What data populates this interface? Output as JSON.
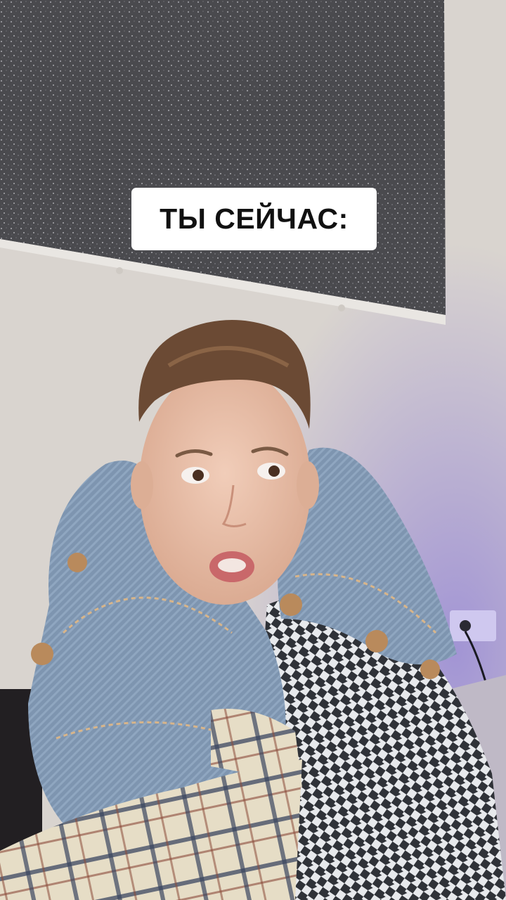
{
  "caption": {
    "text": "ТЫ СЕЙЧАС:"
  },
  "scene": {
    "description_icon": "person-in-blanket-illustration",
    "colors": {
      "wall": "#d9d4cf",
      "panel": "#4c4c50",
      "denim": "#7d93ad",
      "skin": "#e9c3ae",
      "hair": "#6b4a34",
      "plaid": "#e3dbc4",
      "purple_glow": "#8f7fd6"
    }
  }
}
